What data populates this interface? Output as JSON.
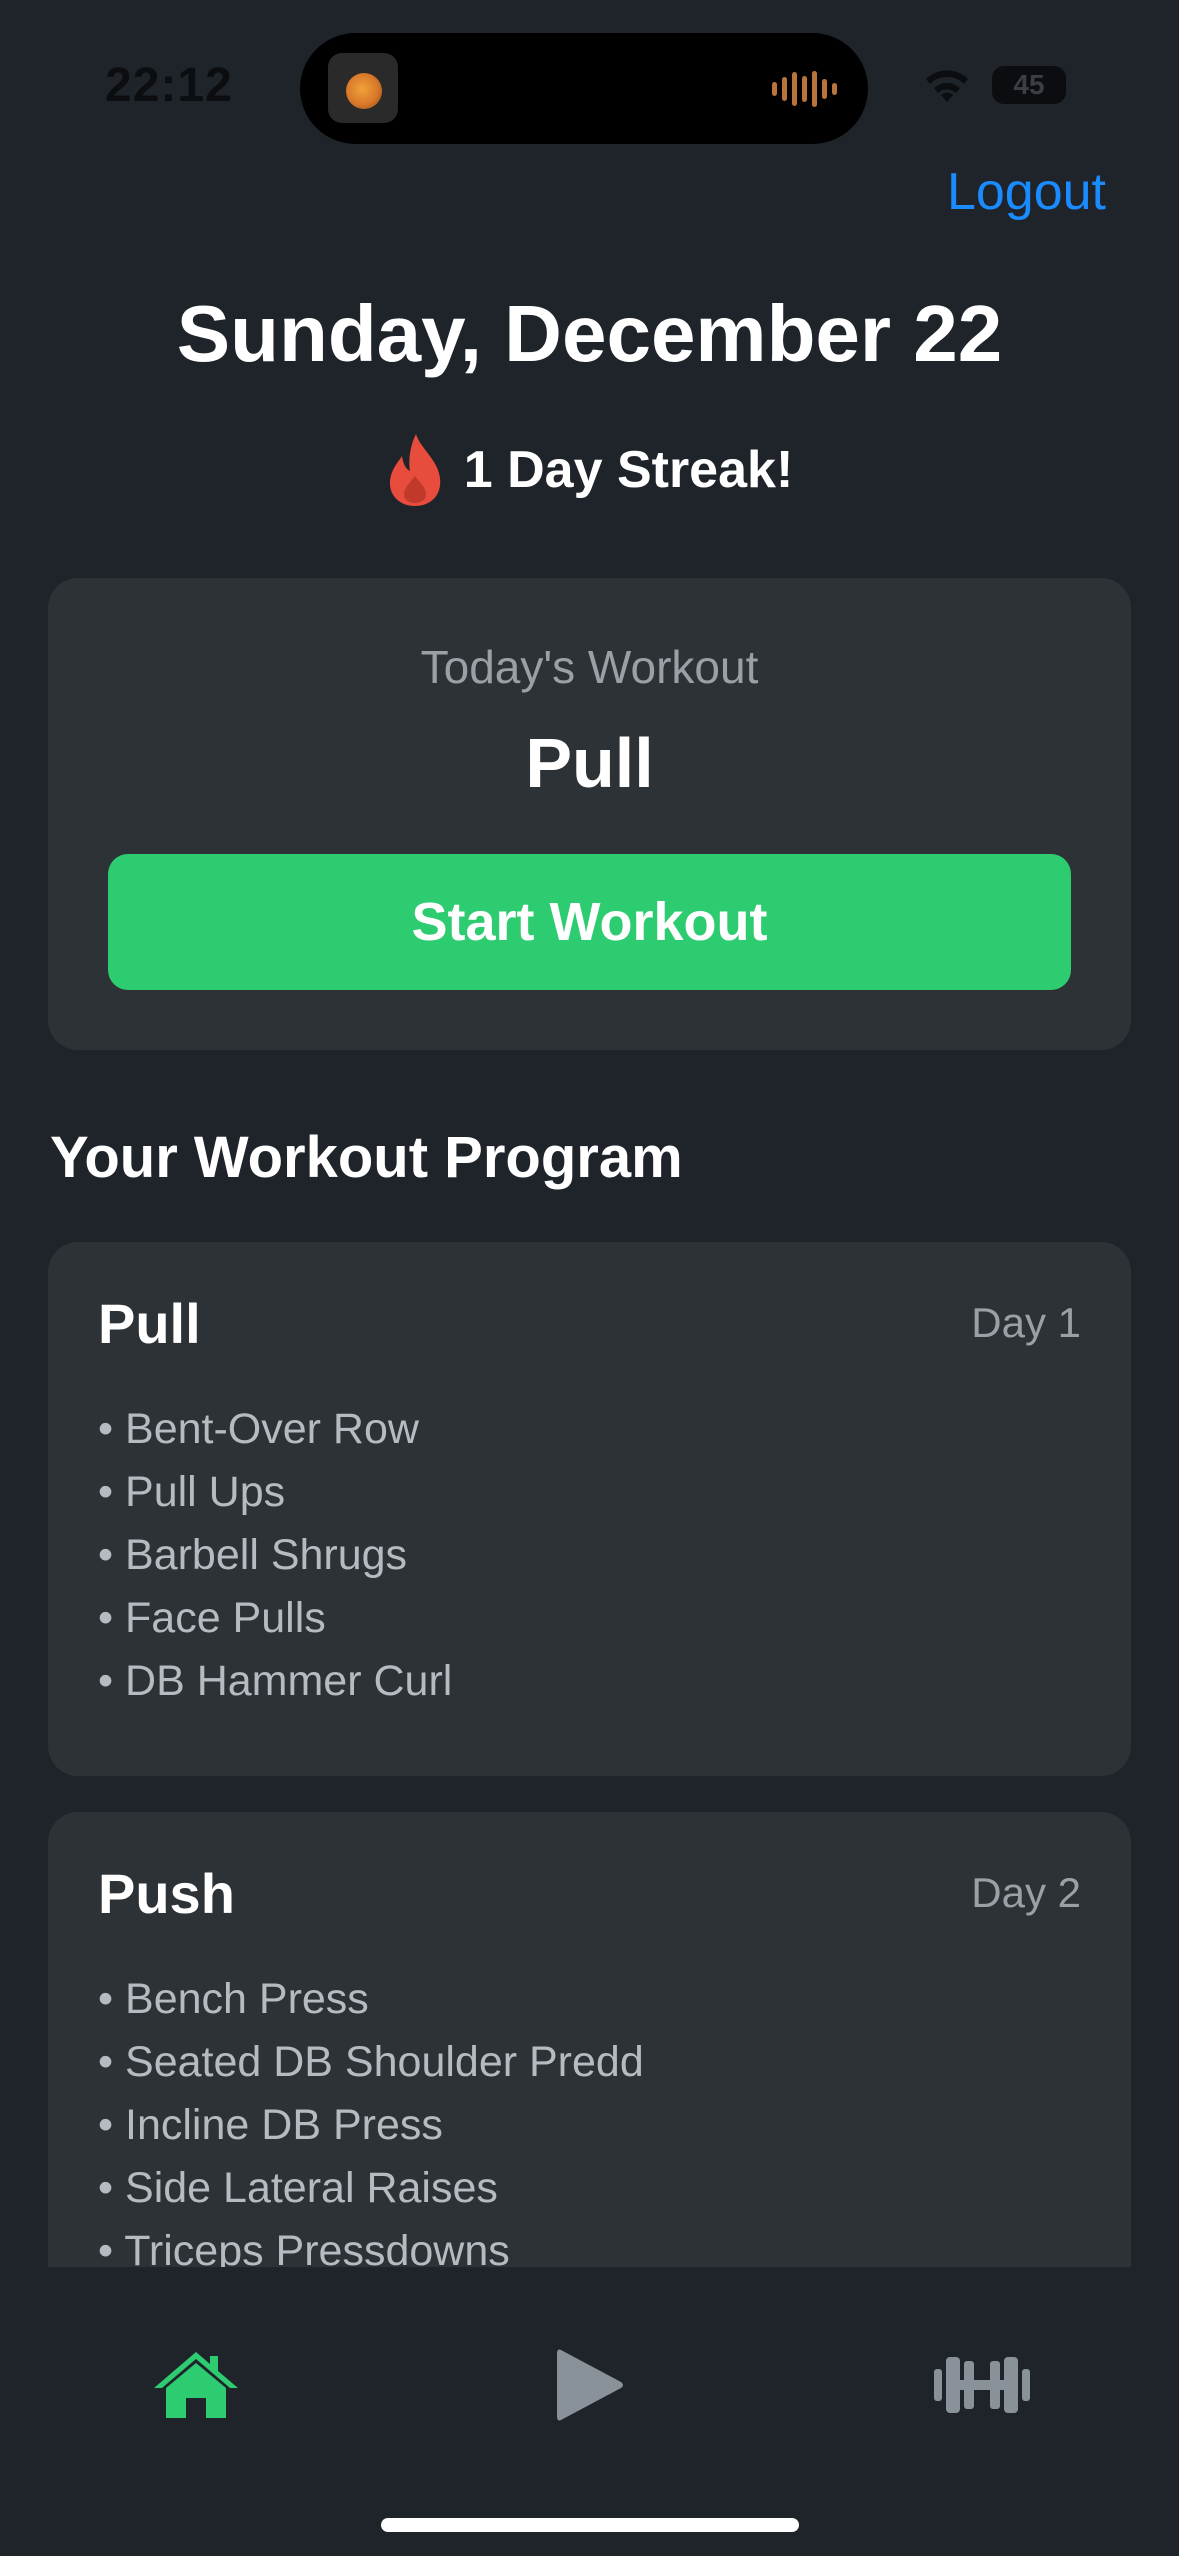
{
  "status_bar": {
    "time": "22:12",
    "battery": "45"
  },
  "header": {
    "logout_label": "Logout"
  },
  "date_title": "Sunday, December 22",
  "streak": {
    "icon": "flame-icon",
    "text": "1 Day Streak!"
  },
  "today": {
    "label": "Today's Workout",
    "workout_name": "Pull",
    "start_label": "Start Workout"
  },
  "program": {
    "heading": "Your Workout Program",
    "days": [
      {
        "name": "Pull",
        "day_label": "Day 1",
        "exercises": [
          "Bent-Over Row",
          "Pull Ups",
          "Barbell Shrugs",
          "Face Pulls",
          "DB Hammer Curl"
        ]
      },
      {
        "name": "Push",
        "day_label": "Day 2",
        "exercises": [
          "Bench Press",
          "Seated DB Shoulder Predd",
          "Incline DB Press",
          "Side Lateral Raises",
          "Triceps Pressdowns"
        ]
      }
    ]
  },
  "tabbar": {
    "tabs": [
      {
        "icon": "home-icon",
        "active": true
      },
      {
        "icon": "play-icon",
        "active": false
      },
      {
        "icon": "dumbbell-icon",
        "active": false
      }
    ]
  },
  "colors": {
    "background": "#1f242b",
    "card": "#2d3236",
    "accent_green": "#2ecc71",
    "link_blue": "#1a8cff",
    "inactive_icon": "#8a9299"
  }
}
